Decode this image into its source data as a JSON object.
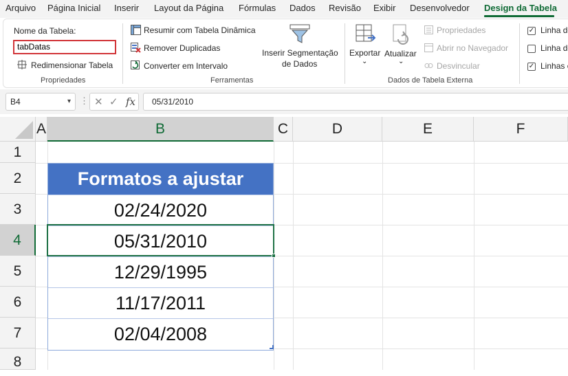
{
  "menu": {
    "tabs": [
      "Arquivo",
      "Página Inicial",
      "Inserir",
      "Layout da Página",
      "Fórmulas",
      "Dados",
      "Revisão",
      "Exibir",
      "Desenvolvedor",
      "Design da Tabela"
    ],
    "active_tab": "Design da Tabela"
  },
  "ribbon": {
    "propriedades": {
      "table_name_label": "Nome da Tabela:",
      "table_name_value": "tabDatas",
      "resize_label": "Redimensionar Tabela",
      "group_label": "Propriedades"
    },
    "ferramentas": {
      "pivot_label": "Resumir com Tabela Dinâmica",
      "remove_dup_label": "Remover Duplicadas",
      "convert_label": "Converter em Intervalo",
      "slicer_label_1": "Inserir Segmentação",
      "slicer_label_2": "de Dados",
      "group_label": "Ferramentas"
    },
    "dados_externos": {
      "export_label": "Exportar",
      "refresh_label": "Atualizar",
      "properties_label": "Propriedades",
      "browser_label": "Abrir no Navegador",
      "unlink_label": "Desvincular",
      "group_label": "Dados de Tabela Externa"
    },
    "opcoes": {
      "header_row_label": "Linha de",
      "total_row_label": "Linha de",
      "banded_rows_label": "Linhas e"
    }
  },
  "formula_bar": {
    "name_box": "B4",
    "formula": "05/31/2010"
  },
  "grid": {
    "columns": [
      "A",
      "B",
      "C",
      "D",
      "E",
      "F"
    ],
    "rows": [
      "1",
      "2",
      "3",
      "4",
      "5",
      "6",
      "7",
      "8"
    ],
    "selected_column": "B",
    "selected_row": "4"
  },
  "table": {
    "header": "Formatos a ajustar",
    "values": [
      "02/24/2020",
      "05/31/2010",
      "12/29/1995",
      "11/17/2011",
      "02/04/2008"
    ]
  },
  "colors": {
    "accent_green": "#106b36",
    "table_header": "#4472c4",
    "highlight_box": "#d13438"
  }
}
